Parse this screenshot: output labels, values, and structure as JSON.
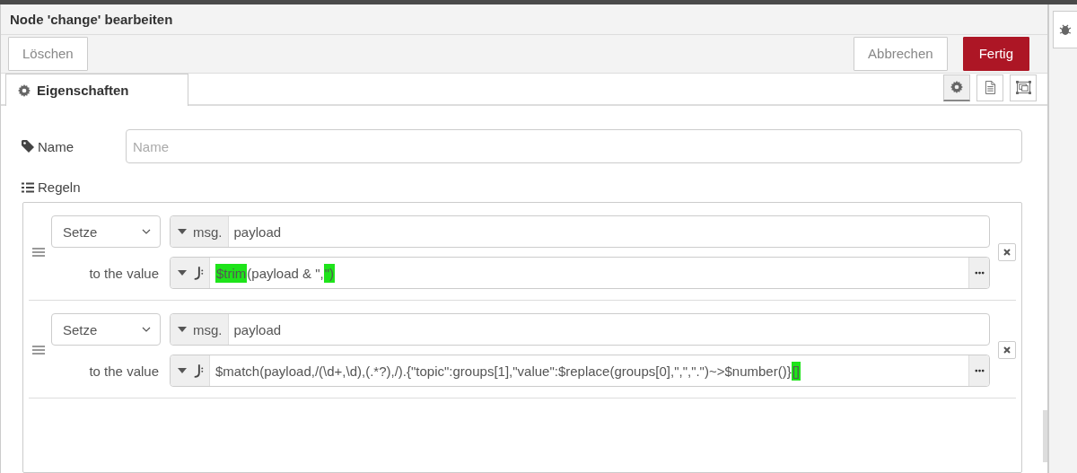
{
  "window": {
    "title": "Node 'change' bearbeiten"
  },
  "buttons": {
    "delete": "Löschen",
    "cancel": "Abbrechen",
    "done": "Fertig"
  },
  "tabs": [
    {
      "label": "Eigenschaften",
      "selected": true
    }
  ],
  "tab_tools": [
    {
      "kind": "settings",
      "selected": true
    },
    {
      "kind": "description",
      "selected": false
    },
    {
      "kind": "appearance",
      "selected": false
    }
  ],
  "name_field": {
    "label": "Name",
    "placeholder": "Name"
  },
  "rules_label": "Regeln",
  "rules": [
    {
      "action": "Setze",
      "target_prefix": "msg.",
      "target": "payload",
      "value_label": "to the value",
      "value_segments": [
        {
          "text": "$trim",
          "highlighted": true
        },
        {
          "text": "(payload & \",",
          "highlighted": false
        },
        {
          "text": "\")",
          "highlighted": true
        }
      ]
    },
    {
      "action": "Setze",
      "target_prefix": "msg.",
      "target": "payload",
      "value_label": "to the value",
      "value_segments": [
        {
          "text": "$match(payload,/(\\d+,\\d),(.*?),/).{\"topic\":groups[1],\"value\":$replace(groups[0],\",\",\".\")~>$number()}",
          "highlighted": false
        },
        {
          "text": "[]",
          "highlighted": true
        }
      ]
    }
  ]
}
